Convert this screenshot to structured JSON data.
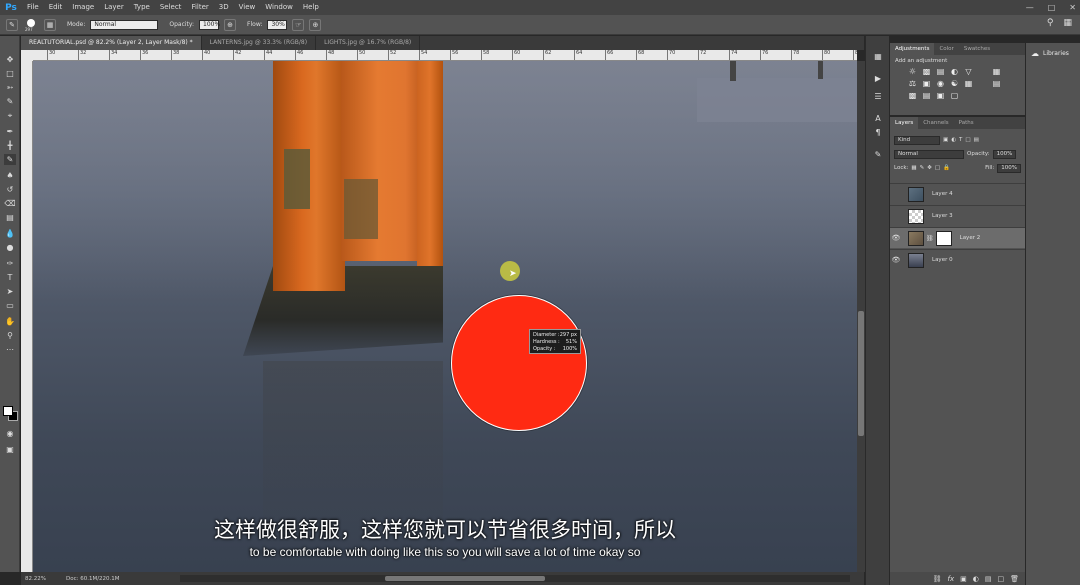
{
  "app": {
    "logo": "Ps"
  },
  "menu": [
    "File",
    "Edit",
    "Image",
    "Layer",
    "Type",
    "Select",
    "Filter",
    "3D",
    "View",
    "Window",
    "Help"
  ],
  "options": {
    "brush_size": "297",
    "mode_label": "Mode:",
    "mode_value": "Normal",
    "opacity_label": "Opacity:",
    "opacity_value": "100%",
    "flow_label": "Flow:",
    "flow_value": "30%"
  },
  "tabs": [
    {
      "label": "REALTUTORIAL.psd @ 82.2% (Layer 2, Layer Mask/8) *",
      "active": true
    },
    {
      "label": "LANTERNS.jpg @ 33.3% (RGB/8)",
      "active": false
    },
    {
      "label": "LIGHTS.jpg @ 16.7% (RGB/8)",
      "active": false
    }
  ],
  "ruler_ticks": [
    "30",
    "32",
    "34",
    "36",
    "38",
    "40",
    "42",
    "44",
    "46",
    "48",
    "50",
    "52",
    "54",
    "56",
    "58",
    "60",
    "62",
    "64",
    "66",
    "68",
    "70",
    "72",
    "74",
    "76",
    "78",
    "80",
    "82"
  ],
  "brush_tip": {
    "diameter_label": "Diameter :",
    "diameter_value": "297 px",
    "hardness_label": "Hardness :",
    "hardness_value": "51%",
    "opacity_label": "Opacity :",
    "opacity_value": "100%"
  },
  "subtitles": {
    "cn": "这样做很舒服，这样您就可以节省很多时间，所以",
    "en": "to be comfortable with doing like this so you will save a lot of time okay so"
  },
  "status": {
    "zoom": "82.22%",
    "doc": "Doc: 60.1M/220.1M"
  },
  "adjustments": {
    "tabs": [
      "Adjustments",
      "Color",
      "Swatches"
    ],
    "title": "Add an adjustment"
  },
  "libraries": {
    "label": "Libraries"
  },
  "layers_panel": {
    "tabs": [
      "Layers",
      "Channels",
      "Paths"
    ],
    "kind_label": "Kind",
    "blend_mode": "Normal",
    "opacity_label": "Opacity:",
    "opacity_value": "100%",
    "lock_label": "Lock:",
    "fill_label": "Fill:",
    "fill_value": "100%",
    "layers": [
      {
        "name": "Layer 4",
        "visible": false,
        "selected": false
      },
      {
        "name": "Layer 3",
        "visible": false,
        "selected": false
      },
      {
        "name": "Layer 2",
        "visible": true,
        "selected": true
      },
      {
        "name": "Layer 0",
        "visible": true,
        "selected": false
      }
    ]
  },
  "colors": {
    "foreground": "#ffffff",
    "background": "#000000",
    "brush_overlay": "#ff2a12"
  }
}
